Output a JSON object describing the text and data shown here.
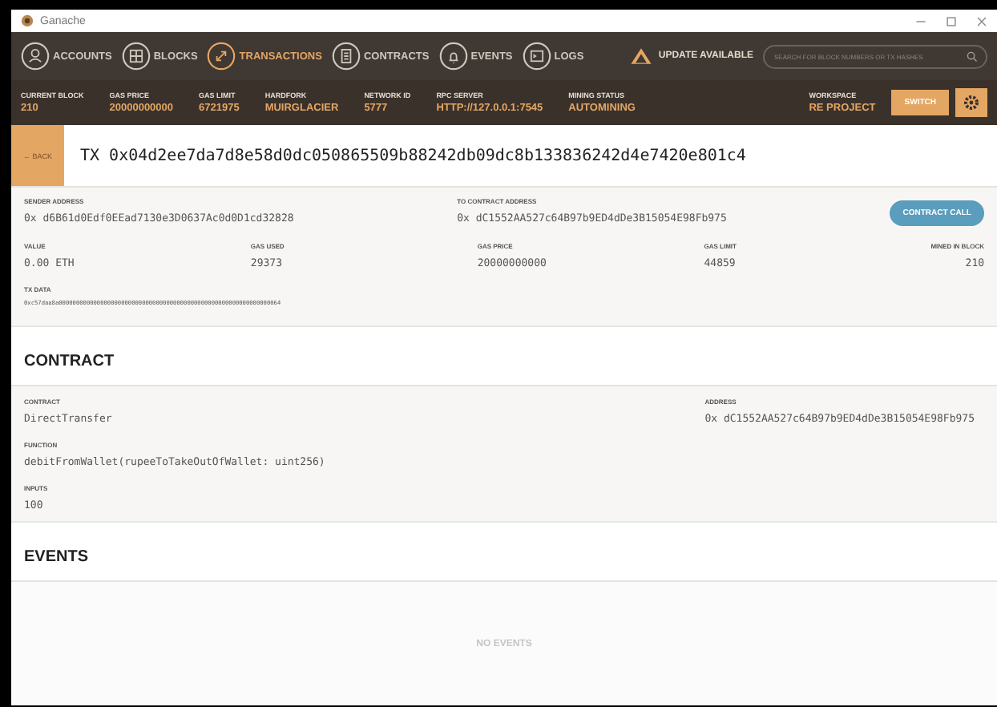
{
  "window": {
    "title": "Ganache"
  },
  "nav": {
    "tabs": [
      {
        "label": "ACCOUNTS",
        "kind": "accounts",
        "selected": false
      },
      {
        "label": "BLOCKS",
        "kind": "blocks",
        "selected": false
      },
      {
        "label": "TRANSACTIONS",
        "kind": "transactions",
        "selected": true
      },
      {
        "label": "CONTRACTS",
        "kind": "contracts",
        "selected": false
      },
      {
        "label": "EVENTS",
        "kind": "events",
        "selected": false
      },
      {
        "label": "LOGS",
        "kind": "logs",
        "selected": false
      }
    ],
    "update": "UPDATE AVAILABLE",
    "search": {
      "placeholder": "SEARCH FOR BLOCK NUMBERS OR TX HASHES"
    }
  },
  "stats": [
    {
      "label": "CURRENT BLOCK",
      "value": "210"
    },
    {
      "label": "GAS PRICE",
      "value": "20000000000"
    },
    {
      "label": "GAS LIMIT",
      "value": "6721975"
    },
    {
      "label": "HARDFORK",
      "value": "MUIRGLACIER"
    },
    {
      "label": "NETWORK ID",
      "value": "5777"
    },
    {
      "label": "RPC SERVER",
      "value": "HTTP://127.0.0.1:7545"
    },
    {
      "label": "MINING STATUS",
      "value": "AUTOMINING"
    }
  ],
  "workspace": {
    "label": "WORKSPACE",
    "value": "RE PROJECT",
    "switch": "SWITCH"
  },
  "tx": {
    "back": "← BACK",
    "title": "TX 0x04d2ee7da7d8e58d0dc050865509b88242db09dc8b133836242d4e7420e801c4",
    "sender": {
      "label": "SENDER ADDRESS",
      "value": "0x d6B61d0Edf0EEad7130e3D0637Ac0d0D1cd32828"
    },
    "to": {
      "label": "TO CONTRACT ADDRESS",
      "value": "0x dC1552AA527c64B97b9ED4dDe3B15054E98Fb975"
    },
    "badge": "CONTRACT CALL",
    "fields": [
      {
        "label": "VALUE",
        "value": "0.00 ETH"
      },
      {
        "label": "GAS USED",
        "value": "29373"
      },
      {
        "label": "GAS PRICE",
        "value": "20000000000"
      },
      {
        "label": "GAS LIMIT",
        "value": "44859"
      },
      {
        "label": "MINED IN BLOCK",
        "value": "210"
      }
    ],
    "data": {
      "label": "TX DATA",
      "value": "0xc57daa8a0000000000000000000000000000000000000000000000000000000000000064"
    }
  },
  "contract": {
    "heading": "CONTRACT",
    "name": {
      "label": "CONTRACT",
      "value": "DirectTransfer"
    },
    "address": {
      "label": "ADDRESS",
      "value": "0x dC1552AA527c64B97b9ED4dDe3B15054E98Fb975"
    },
    "function": {
      "label": "FUNCTION",
      "value": "debitFromWallet(rupeeToTakeOutOfWallet: uint256)"
    },
    "inputs": {
      "label": "INPUTS",
      "value": "100"
    }
  },
  "events": {
    "heading": "EVENTS",
    "empty": "NO EVENTS"
  }
}
